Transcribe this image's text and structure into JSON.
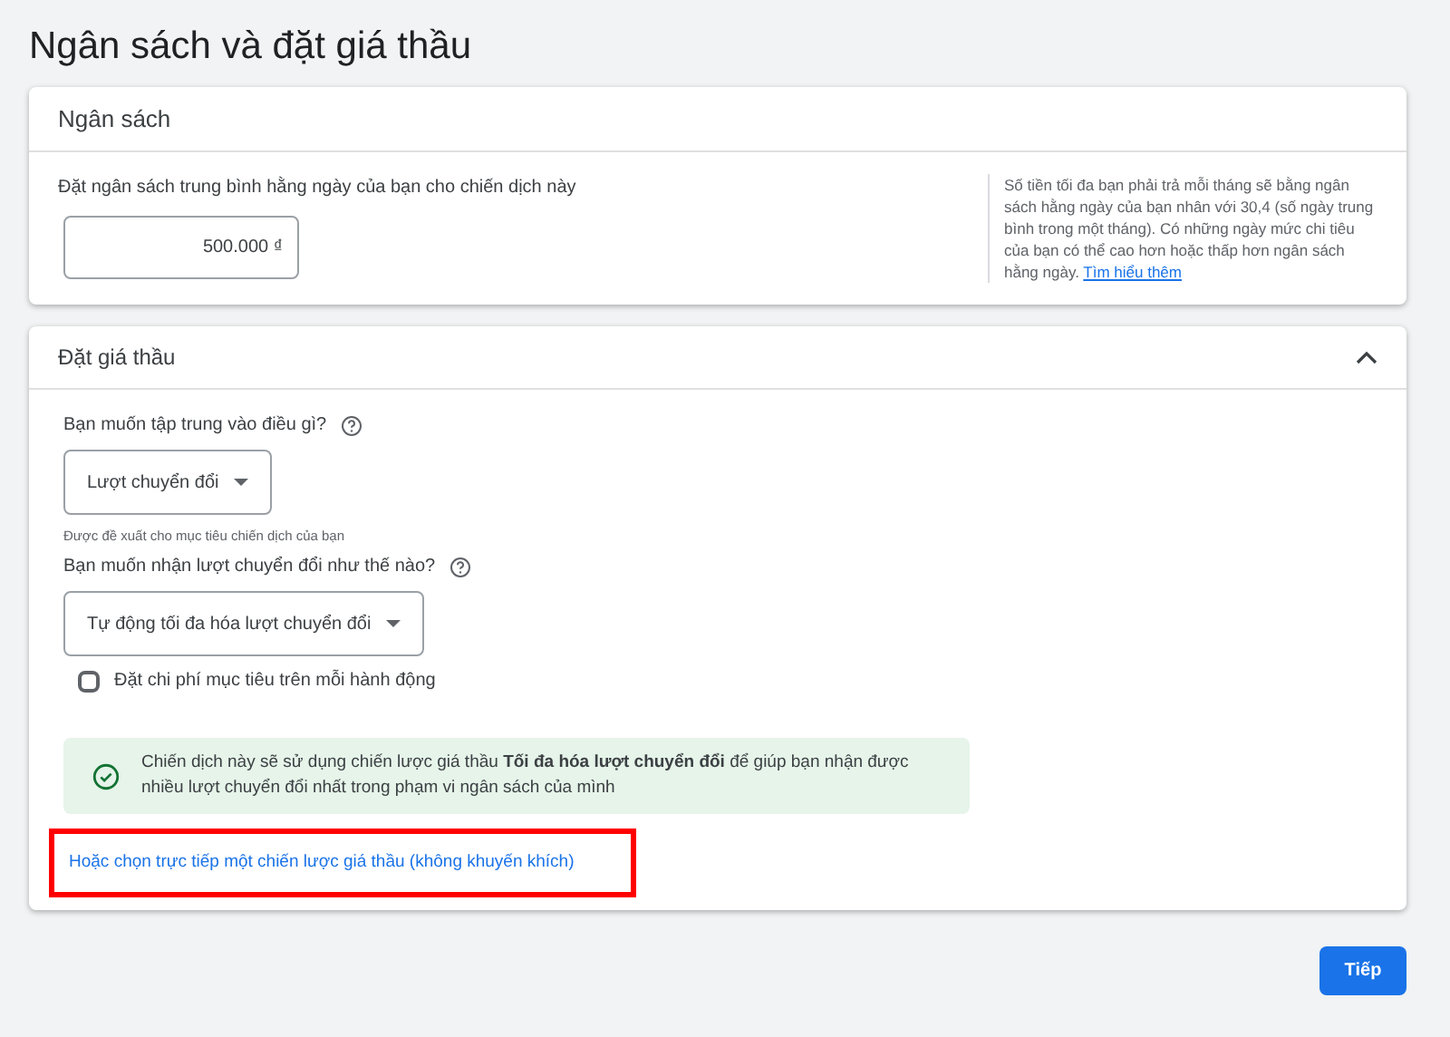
{
  "title": "Ngân sách và đặt giá thầu",
  "budget_card": {
    "title": "Ngân sách",
    "label": "Đặt ngân sách trung bình hằng ngày của bạn cho chiến dịch này",
    "value": "500.000 ₫",
    "help": "Số tiền tối đa bạn phải trả mỗi tháng sẽ bằng ngân sách hằng ngày của bạn nhân với 30,4 (số ngày trung bình trong một tháng). Có những ngày mức chi tiêu của bạn có thể cao hơn hoặc thấp hơn ngân sách hằng ngày.",
    "help_link": "Tìm hiểu thêm"
  },
  "bidding_card": {
    "title": "Đặt giá thầu",
    "expanded": true,
    "focus_label": "Bạn muốn tập trung vào điều gì?",
    "focus_value": "Lượt chuyển đổi",
    "focus_hint": "Được đề xuất cho mục tiêu chiến dịch của bạn",
    "method_label": "Bạn muốn nhận lượt chuyển đổi như thế nào?",
    "method_value": "Tự động tối đa hóa lượt chuyển đổi",
    "checkbox": {
      "label": "Đặt chi phí mục tiêu trên mỗi hành động",
      "checked": false
    },
    "notice": "Chiến dịch này sẽ sử dụng chiến lược giá thầu **Tối đa hóa lượt chuyển đổi** để giúp bạn nhận được nhiều lượt chuyển đổi nhất trong phạm vi ngân sách của mình",
    "link": {
      "text": "Hoặc chọn trực tiếp một chiến lược giá thầu (không khuyến khích)",
      "highlighted": true
    }
  },
  "next_button": "Tiếp"
}
